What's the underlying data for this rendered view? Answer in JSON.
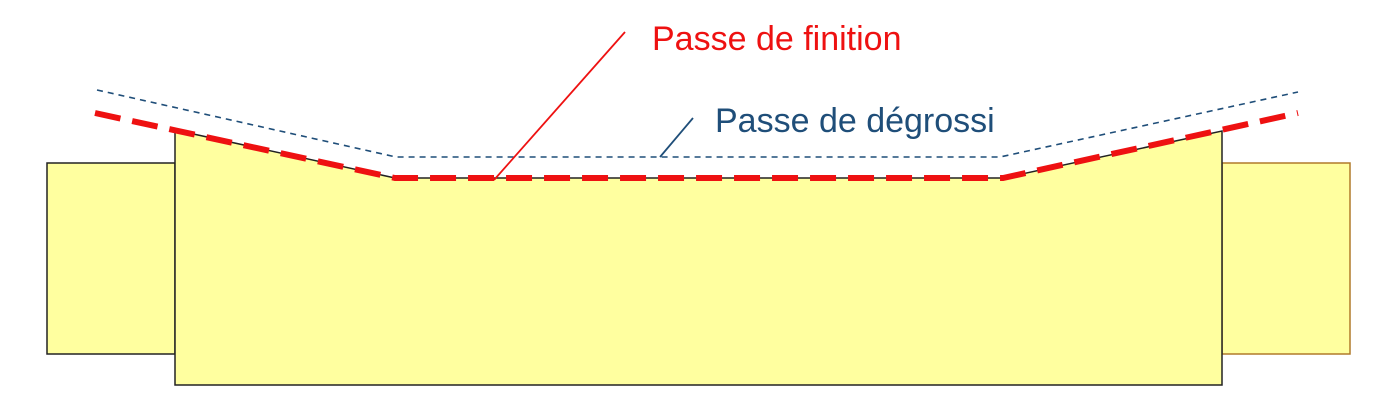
{
  "labels": {
    "finishing_pass": "Passe de finition",
    "roughing_pass": "Passe de dégrossi"
  },
  "colors": {
    "part_fill": "#ffff9f",
    "part_stroke": "#222222",
    "right_shaft_stroke": "#b07a2a",
    "finishing_color": "#ee1111",
    "roughing_color": "#1f4e79"
  }
}
